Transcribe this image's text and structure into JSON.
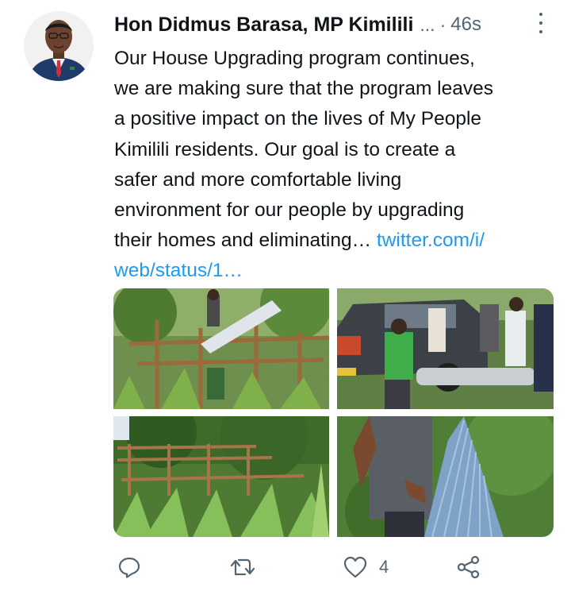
{
  "tweet": {
    "author_name": "Hon Didmus Barasa, MP Kimilili",
    "name_truncation": "...",
    "separator": "·",
    "timestamp": "46s",
    "text_lines": [
      "Our House Upgrading program continues,",
      "we are making sure that the program leaves",
      "a positive impact on the lives  of My People",
      "Kimilili residents.    Our goal is to create a",
      "safer and more comfortable living",
      "environment for our people by upgrading",
      "their homes and eliminating… "
    ],
    "link_part1": "twitter.com/i/",
    "link_part2": "web/status/1…"
  },
  "media": [
    {
      "icon": "photo-roof-construction"
    },
    {
      "icon": "photo-unloading-iron-sheets"
    },
    {
      "icon": "photo-house-frame-in-maize-field"
    },
    {
      "icon": "photo-man-holding-iron-sheet"
    }
  ],
  "actions": {
    "reply_icon": "reply-icon",
    "retweet_icon": "retweet-icon",
    "like_icon": "like-icon",
    "like_count": "4",
    "share_icon": "share-icon"
  },
  "colors": {
    "text": "#0f1419",
    "secondary": "#536471",
    "link": "#1d9bf0",
    "background": "#ffffff"
  }
}
